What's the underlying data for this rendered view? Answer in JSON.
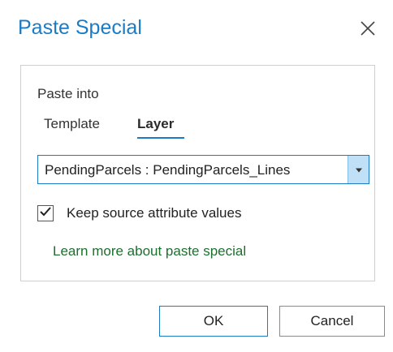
{
  "dialog": {
    "title": "Paste Special",
    "accent_color": "#1d7bc4",
    "close_icon": "close-icon"
  },
  "paste_into": {
    "label": "Paste into",
    "tabs": [
      {
        "label": "Template",
        "selected": false
      },
      {
        "label": "Layer",
        "selected": true
      }
    ]
  },
  "layer_select": {
    "value": "PendingParcels : PendingParcels_Lines",
    "arrow_icon": "chevron-down-icon"
  },
  "keep_attributes": {
    "label": "Keep source attribute values",
    "checked": true
  },
  "help_link": {
    "label": "Learn more about paste special",
    "color": "#1e6e2e"
  },
  "buttons": {
    "ok": "OK",
    "cancel": "Cancel"
  }
}
